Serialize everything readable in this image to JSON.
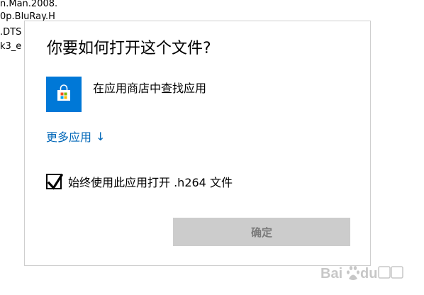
{
  "background_files": [
    "n.Man.2008.",
    "0p.BluRay.H",
    ".DTS",
    "k3_e"
  ],
  "dialog": {
    "title": "你要如何打开这个文件?",
    "store_option_label": "在应用商店中查找应用",
    "more_apps_label": "更多应用",
    "more_apps_arrow": "↓",
    "always_use_label": "始终使用此应用打开 .h264 文件",
    "always_use_checked": true,
    "ok_button_label": "确定"
  },
  "icons": {
    "store": "microsoft-store-icon",
    "checkmark": "checkmark-icon",
    "arrow": "arrow-down-icon"
  },
  "colors": {
    "accent_blue": "#0078d7",
    "link_blue": "#0067b8",
    "button_disabled_bg": "#cccccc",
    "button_disabled_text": "#7a7a7a"
  },
  "watermark": {
    "brand": "Baidu 经验"
  }
}
